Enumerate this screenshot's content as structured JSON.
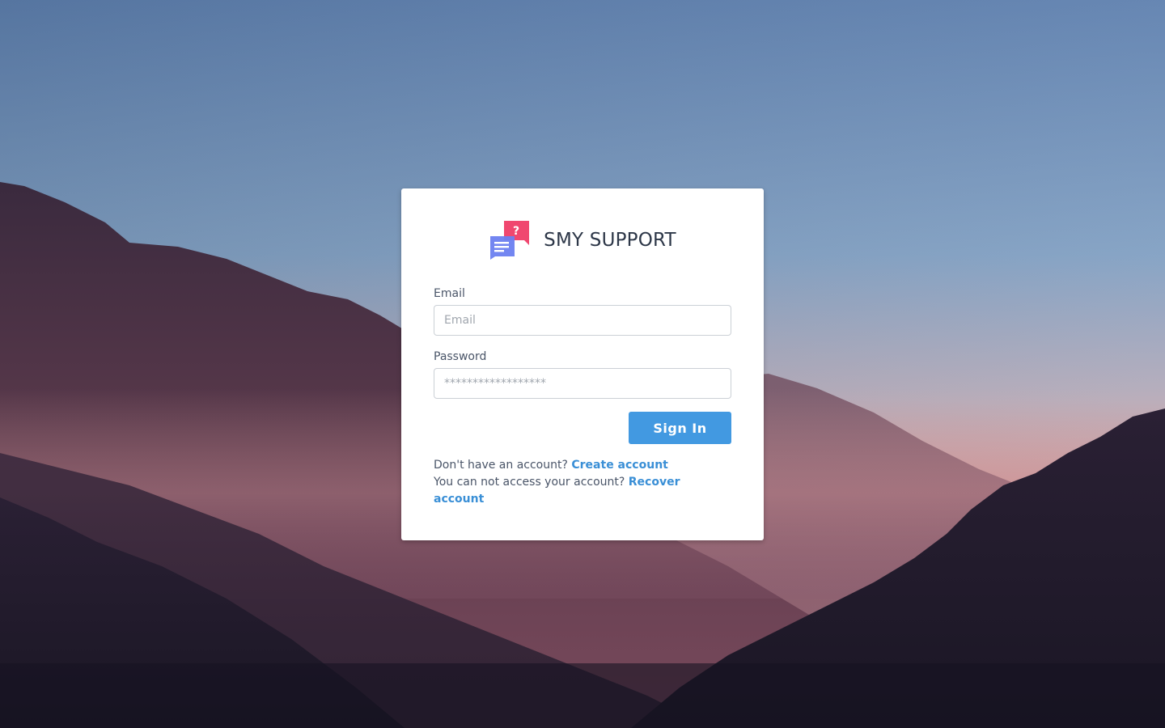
{
  "brand": {
    "title": "SMY SUPPORT",
    "logo_icon": "chat-question-icon",
    "logo_colors": {
      "front": "#6b7ff0",
      "back": "#f0476f"
    }
  },
  "form": {
    "email_label": "Email",
    "email_placeholder": "Email",
    "email_value": "",
    "password_label": "Password",
    "password_placeholder": "******************",
    "password_value": "",
    "submit_label": "Sign In"
  },
  "links": {
    "signup_prompt": "Don't have an account?",
    "signup_link": "Create account",
    "recover_prompt": "You can not access your account?",
    "recover_link": "Recover account"
  },
  "colors": {
    "accent": "#4299e1",
    "link": "#3a8fd6"
  }
}
